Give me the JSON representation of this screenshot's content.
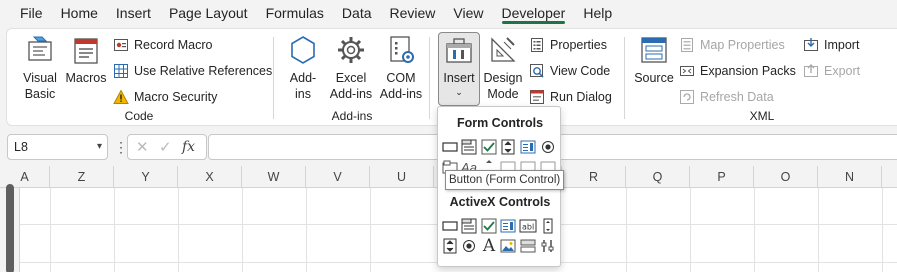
{
  "menubar": {
    "items": [
      "File",
      "Home",
      "Insert",
      "Page Layout",
      "Formulas",
      "Data",
      "Review",
      "View",
      "Developer",
      "Help"
    ],
    "active": "Developer"
  },
  "ribbon": {
    "code": {
      "label": "Code",
      "visual_basic": "Visual Basic",
      "macros": "Macros",
      "record_macro": "Record Macro",
      "use_relative": "Use Relative References",
      "macro_security": "Macro Security"
    },
    "addins": {
      "label": "Add-ins",
      "addins": "Add-ins",
      "excel_addins": "Excel Add-ins",
      "com_addins": "COM Add-ins"
    },
    "controls": {
      "insert": "Insert",
      "design_mode": "Design Mode",
      "properties": "Properties",
      "view_code": "View Code",
      "run_dialog": "Run Dialog"
    },
    "xml": {
      "label": "XML",
      "source": "Source",
      "map_properties": "Map Properties",
      "expansion_packs": "Expansion Packs",
      "refresh_data": "Refresh Data",
      "import": "Import",
      "export": "Export"
    }
  },
  "formula_bar": {
    "name_box": "L8",
    "fx": "fx",
    "value": ""
  },
  "grid": {
    "columns": [
      "A",
      "Z",
      "Y",
      "X",
      "W",
      "V",
      "U",
      "",
      "R",
      "Q",
      "P",
      "O",
      "N"
    ]
  },
  "insert_dropdown": {
    "form_controls_label": "Form Controls",
    "activex_controls_label": "ActiveX Controls",
    "tooltip": "Button (Form Control)"
  },
  "colors": {
    "accent": "#217346",
    "check": "#1e7b45",
    "blue_icon": "#2b6cb0"
  }
}
